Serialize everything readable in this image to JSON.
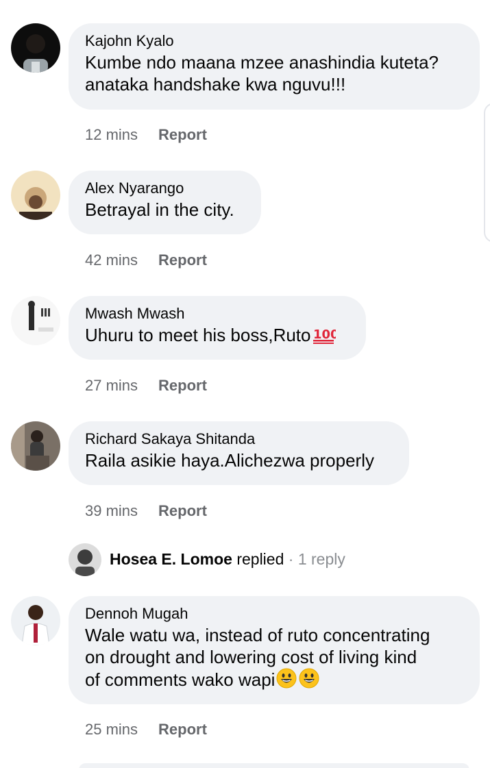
{
  "comments": [
    {
      "author": "Kajohn Kyalo",
      "text": "Kumbe ndo maana mzee anashindia kuteta?\nanataka handshake kwa nguvu!!!",
      "time": "12 mins",
      "report": "Report",
      "avatar_icon": "avatar-dark-photo"
    },
    {
      "author": "Alex Nyarango",
      "text": "Betrayal in the city.",
      "time": "42 mins",
      "report": "Report",
      "avatar_icon": "avatar-light-photo"
    },
    {
      "author": "Mwash Mwash",
      "text": "Uhuru to meet his boss,Ruto",
      "emoji": "hundred-points-emoji",
      "time": "27 mins",
      "report": "Report",
      "avatar_icon": "avatar-figure-photo"
    },
    {
      "author": "Richard Sakaya Shitanda",
      "text": "Raila asikie haya.Alichezwa properly",
      "time": "39 mins",
      "report": "Report",
      "avatar_icon": "avatar-seated-photo"
    },
    {
      "author": "Dennoh Mugah",
      "text": "Wale watu wa, instead of ruto concentrating\non drought and lowering cost of living kind\nof comments wako wapi",
      "emoji": "smiley-emoji",
      "time": "25 mins",
      "report": "Report",
      "avatar_icon": "avatar-shirt-photo"
    }
  ],
  "reply": {
    "name": "Hosea E. Lomoe",
    "action": " replied",
    "separator": " · ",
    "count": "1 reply"
  },
  "colors": {
    "bubble": "#f0f2f5",
    "text": "#050505",
    "meta": "#65676b"
  }
}
